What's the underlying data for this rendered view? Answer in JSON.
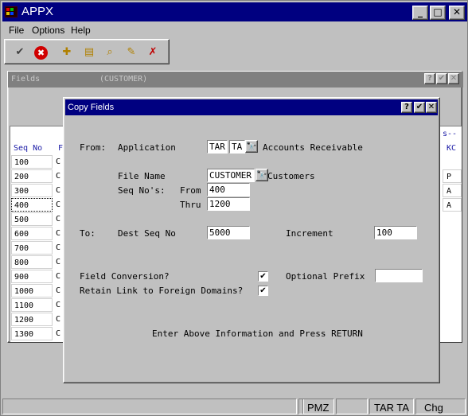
{
  "app": {
    "title": "APPX",
    "minimize": "_",
    "maximize": "□",
    "close": "✕"
  },
  "menu": [
    {
      "label": "File"
    },
    {
      "label": "Options"
    },
    {
      "label": "Help"
    }
  ],
  "toolbar": [
    {
      "icon": "checkmark-doc-icon",
      "glyph": "✔"
    },
    {
      "icon": "cancel-icon",
      "glyph": "✖"
    },
    {
      "icon": "new-folder-icon",
      "glyph": "✚"
    },
    {
      "icon": "open-folder-icon",
      "glyph": "▤"
    },
    {
      "icon": "search-folder-icon",
      "glyph": "⌕"
    },
    {
      "icon": "edit-folder-icon",
      "glyph": "✎"
    },
    {
      "icon": "delete-folder-icon",
      "glyph": "✗"
    }
  ],
  "fields_window": {
    "title": "Fields",
    "subtitle": "(CUSTOMER)",
    "help": "?",
    "ok": "✔",
    "close": "✕",
    "col_seq": "Seq No",
    "col_f": "F",
    "col_s": "s--",
    "col_kc": "KC",
    "rows": [
      {
        "seq": "100",
        "c": "C",
        "kc": ""
      },
      {
        "seq": "200",
        "c": "C",
        "kc": "P"
      },
      {
        "seq": "300",
        "c": "C",
        "kc": "A"
      },
      {
        "seq": "400",
        "c": "C",
        "kc": "A"
      },
      {
        "seq": "500",
        "c": "C",
        "kc": ""
      },
      {
        "seq": "600",
        "c": "C",
        "kc": ""
      },
      {
        "seq": "700",
        "c": "C",
        "kc": ""
      },
      {
        "seq": "800",
        "c": "C",
        "kc": ""
      },
      {
        "seq": "900",
        "c": "C",
        "kc": ""
      },
      {
        "seq": "1000",
        "c": "C",
        "kc": ""
      },
      {
        "seq": "1100",
        "c": "C",
        "kc": ""
      },
      {
        "seq": "1200",
        "c": "C",
        "kc": ""
      },
      {
        "seq": "1300",
        "c": "C",
        "kc": ""
      }
    ]
  },
  "dialog": {
    "title": "Copy Fields",
    "help": "?",
    "ok": "✔",
    "close": "✕",
    "from_label": "From:",
    "application_label": "Application",
    "app_code": "TAR",
    "app_ver": "TA",
    "app_name": "Accounts Receivable",
    "file_name_label": "File Name",
    "file_name_value": "CUSTOMER",
    "file_desc": "Customers",
    "seq_nos_label": "Seq No's:",
    "seq_from_label": "From",
    "seq_from_value": "400",
    "seq_thru_label": "Thru",
    "seq_thru_value": "1200",
    "to_label": "To:",
    "dest_seq_label": "Dest Seq No",
    "dest_seq_value": "5000",
    "increment_label": "Increment",
    "increment_value": "100",
    "field_conv_label": "Field Conversion?",
    "field_conv_checked": "✔",
    "optional_prefix_label": "Optional Prefix",
    "optional_prefix_value": "",
    "retain_link_label": "Retain Link to Foreign Domains?",
    "retain_link_checked": "✔",
    "instruction": "Enter Above Information and Press RETURN",
    "lookup_glyph": "🔭"
  },
  "status": {
    "cell1": "",
    "cell2": "",
    "user": "PMZ",
    "cell4": "",
    "app": "TAR TA",
    "mode": "Chg"
  },
  "colors": {
    "titlebar": "#000080",
    "inactive_titlebar": "#808080",
    "face": "#c0c0c0",
    "header_text": "#1a1aa6"
  }
}
